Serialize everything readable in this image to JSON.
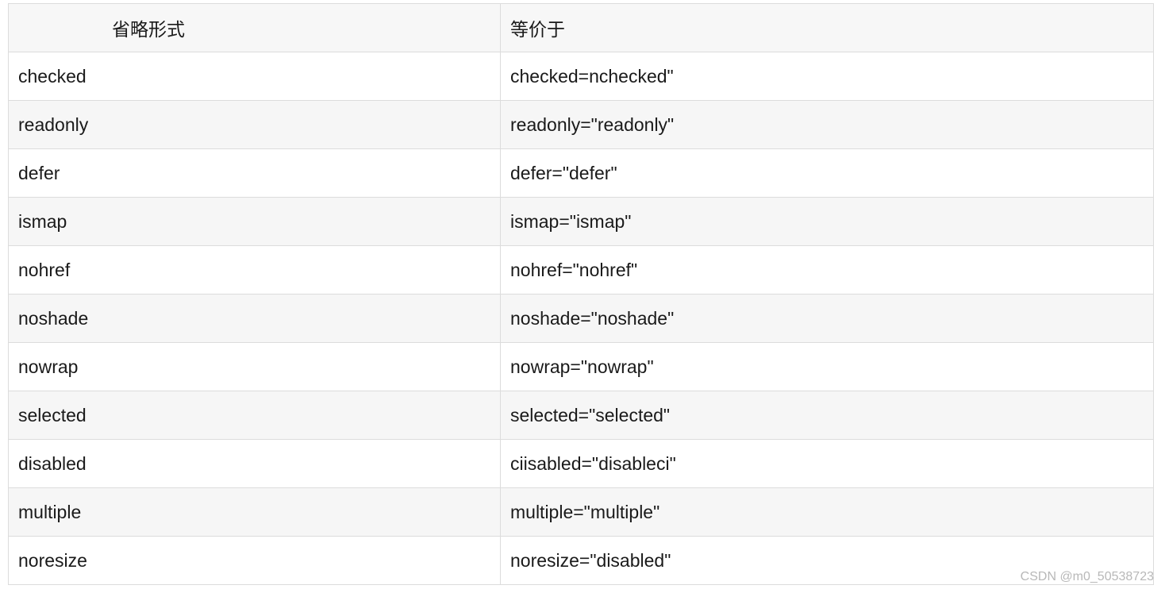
{
  "table": {
    "headers": [
      "省略形式",
      "等价于"
    ],
    "rows": [
      [
        "checked",
        "checked=nchecked\""
      ],
      [
        "readonly",
        "readonly=\"readonly\""
      ],
      [
        "defer",
        "defer=\"defer\""
      ],
      [
        "ismap",
        "ismap=\"ismap\""
      ],
      [
        "nohref",
        "nohref=\"nohref\""
      ],
      [
        "noshade",
        "noshade=\"noshade\""
      ],
      [
        "nowrap",
        "nowrap=\"nowrap\""
      ],
      [
        "selected",
        "selected=\"selected\""
      ],
      [
        "disabled",
        "ciisabled=\"disableci\""
      ],
      [
        "multiple",
        "multiple=\"multiple\""
      ],
      [
        "noresize",
        "noresize=\"disabled\""
      ]
    ]
  },
  "watermark": "CSDN @m0_50538723"
}
